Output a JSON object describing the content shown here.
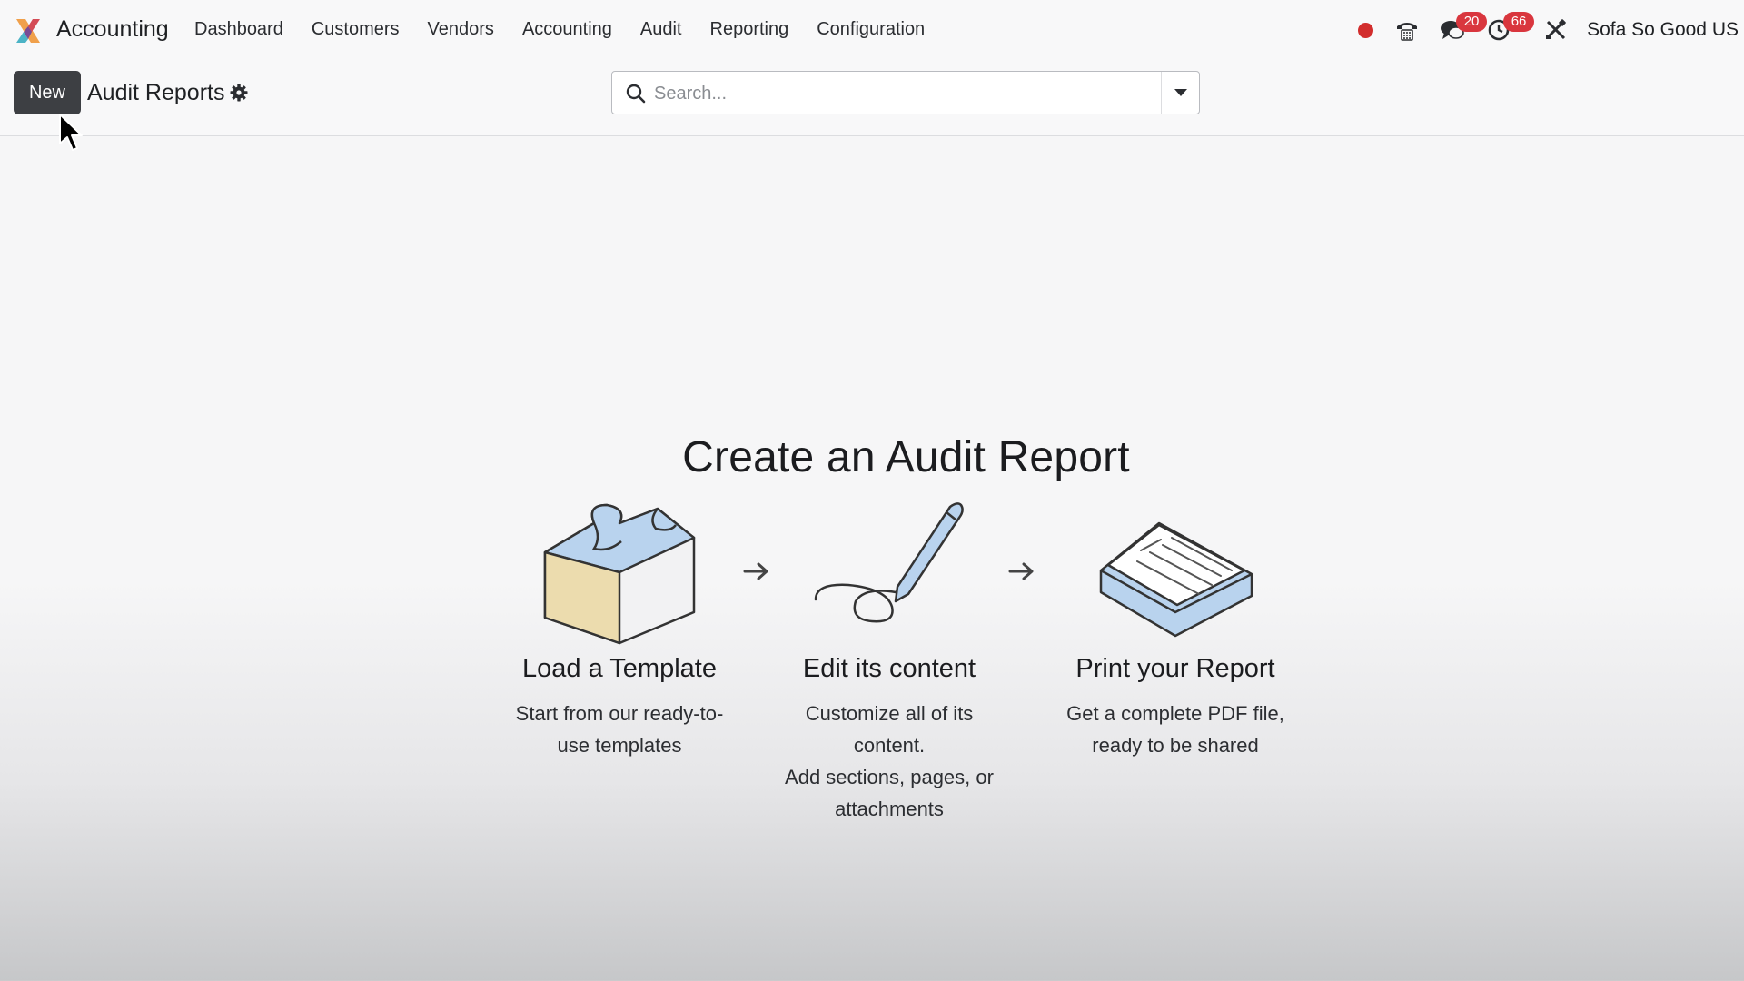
{
  "navbar": {
    "app_name": "Accounting",
    "menu": [
      "Dashboard",
      "Customers",
      "Vendors",
      "Accounting",
      "Audit",
      "Reporting",
      "Configuration"
    ],
    "messages_badge": "20",
    "activities_badge": "66",
    "company": "Sofa So Good US"
  },
  "control_panel": {
    "new_label": "New",
    "breadcrumb": "Audit Reports",
    "search_placeholder": "Search..."
  },
  "helper": {
    "title": "Create an Audit Report",
    "steps": [
      {
        "title": "Load a Template",
        "desc_lines": [
          "Start from our ready-to-",
          "use templates"
        ]
      },
      {
        "title": "Edit its content",
        "desc_lines": [
          "Customize all of its",
          "content.",
          "Add sections, pages, or",
          "attachments"
        ]
      },
      {
        "title": "Print your Report",
        "desc_lines": [
          "Get a complete PDF file,",
          "ready to be shared"
        ]
      }
    ]
  },
  "colors": {
    "new_button": "#3d3f43",
    "badge": "#d9363e",
    "record_dot": "#d22d2d",
    "illustration_blue": "#b9d3ee",
    "illustration_yellow": "#ecdcae"
  },
  "icons": {
    "logo": "accounting-logo-icon",
    "record": "record-dot-icon",
    "phone": "phone-icon",
    "messages": "chat-icon",
    "activities": "clock-icon",
    "debug": "tools-icon",
    "settings": "gear-icon",
    "search": "search-icon"
  }
}
